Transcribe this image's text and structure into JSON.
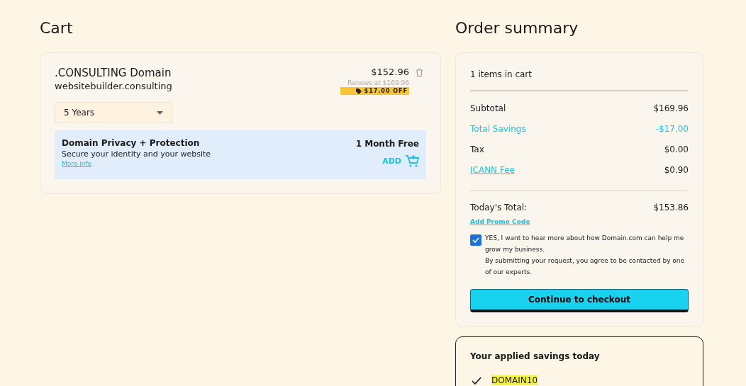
{
  "cart": {
    "title": "Cart",
    "item": {
      "name": ".CONSULTING Domain",
      "domain": "websitebuilder.consulting",
      "price": "$152.96",
      "renews": "Renews at $169.96",
      "discount": "$17.00 OFF",
      "term": "5 Years",
      "addon": {
        "title": "Domain Privacy + Protection",
        "description": "Secure your identity and your website",
        "link": "More info",
        "offer": "1 Month Free",
        "action": "ADD"
      }
    }
  },
  "summary": {
    "title": "Order summary",
    "count": "1 items in cart",
    "rows": [
      {
        "kind": "plain",
        "label": "Subtotal",
        "value": "$169.96"
      },
      {
        "kind": "savings",
        "label": "Total Savings",
        "value": "-$17.00"
      },
      {
        "kind": "plain",
        "label": "Tax",
        "value": "$0.00"
      },
      {
        "kind": "link",
        "label": "ICANN Fee",
        "value": "$0.90"
      }
    ],
    "total": {
      "label": "Today's Total:",
      "value": "$153.86"
    },
    "promo": "Add Promo Code",
    "consent": {
      "checked": true,
      "lines": [
        "YES, I want to hear more about how Domain.com can help me grow my business.",
        "By submitting your request, you agree to be contacted by one of our experts."
      ]
    },
    "checkout": "Continue to checkout"
  },
  "savings": {
    "title": "Your applied savings today",
    "codes": [
      "DOMAIN10"
    ]
  }
}
